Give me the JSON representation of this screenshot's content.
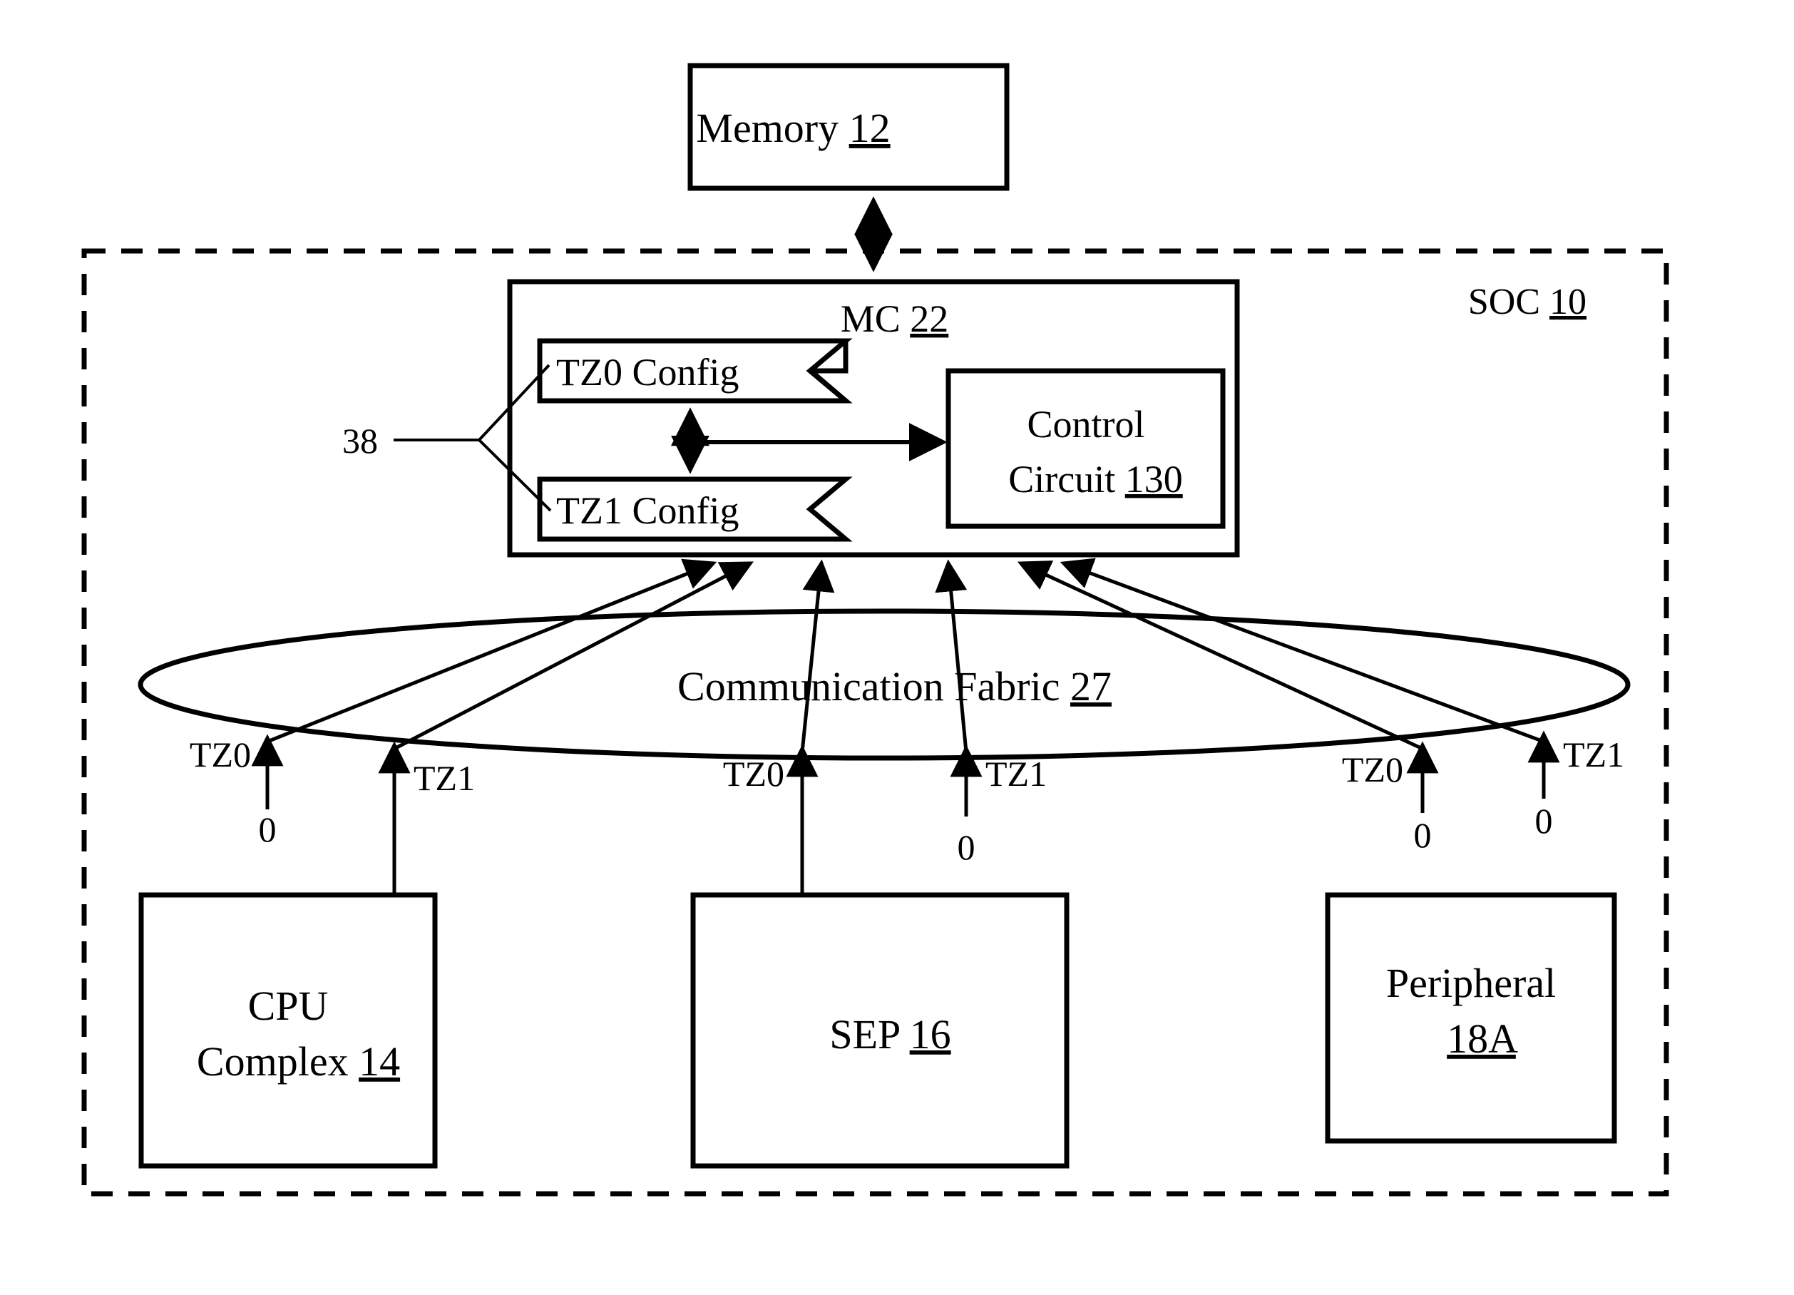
{
  "figure": {
    "kind": "patent-block-diagram",
    "background_color": "#ffffff",
    "line_color": "#000000"
  },
  "memory": {
    "label": "Memory",
    "ref": "12"
  },
  "soc": {
    "label": "SOC",
    "ref": "10"
  },
  "memory_controller": {
    "label": "MC",
    "ref": "22",
    "config_registers": [
      {
        "label": "TZ0 Config",
        "name": "tz0-config"
      },
      {
        "label": "TZ1 Config",
        "name": "tz1-config"
      }
    ],
    "config_group_ref": "38",
    "control_circuit": {
      "line1": "Control",
      "line2": "Circuit",
      "ref": "130"
    }
  },
  "fabric": {
    "label": "Communication Fabric",
    "ref": "27"
  },
  "agents": [
    {
      "name": "cpu-complex",
      "line1": "CPU",
      "line2": "Complex",
      "ref": "14"
    },
    {
      "name": "sep",
      "line1": "SEP",
      "line2": "",
      "ref": "16"
    },
    {
      "name": "peripheral",
      "line1": "Peripheral",
      "line2": "",
      "ref": "18A"
    }
  ],
  "ports": [
    {
      "id": "cpu-tz0",
      "tz_label": "TZ0",
      "value": "0",
      "connected": false
    },
    {
      "id": "cpu-tz1",
      "tz_label": "TZ1",
      "value": "",
      "connected": true
    },
    {
      "id": "sep-tz0",
      "tz_label": "TZ0",
      "value": "",
      "connected": true
    },
    {
      "id": "sep-tz1",
      "tz_label": "TZ1",
      "value": "0",
      "connected": false
    },
    {
      "id": "peri-tz0",
      "tz_label": "TZ0",
      "value": "0",
      "connected": false
    },
    {
      "id": "peri-tz1",
      "tz_label": "TZ1",
      "value": "0",
      "connected": false
    }
  ]
}
